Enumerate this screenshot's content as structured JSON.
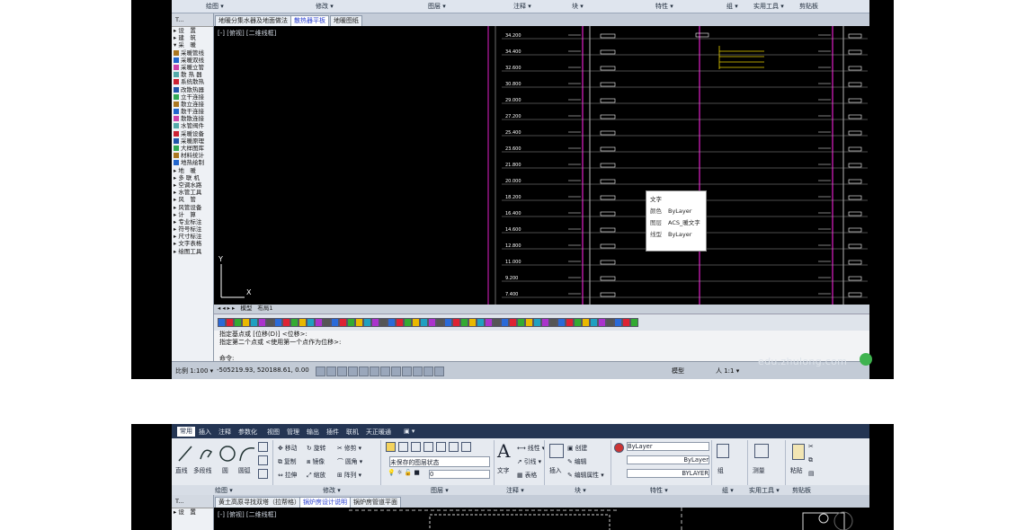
{
  "screenshot1": {
    "ribbon_groups": [
      "绘图 ▾",
      "修改 ▾",
      "图层 ▾",
      "注释 ▾",
      "块 ▾",
      "特性 ▾",
      "组 ▾",
      "实用工具 ▾",
      "剪贴板"
    ],
    "doc_tabs": [
      "地暖分集水器及地面做法",
      "散热器平板",
      "地暖图纸"
    ],
    "active_doc_tab": "散热器平板",
    "viewport_label": "[-] [俯视] [二维线框]",
    "tool_panel": {
      "header": "T...",
      "items": [
        "▸ 设　置",
        "▸ 建　筑",
        "▾ 采　暖",
        "采暖管线",
        "采暖双线",
        "采暖立管",
        "散 热 器",
        "系统散热",
        "改散热器",
        "立干连接",
        "散立连接",
        "散干连接",
        "散散连接",
        "水管阀件",
        "采暖设备",
        "采暖原理",
        "大样图库",
        "材料统计",
        "地热绘制",
        "▸ 地　暖",
        "▸ 多 联 机",
        "▸ 空调水路",
        "▸ 水管工具",
        "▸ 风　管",
        "▸ 风管设备",
        "▸ 计　算",
        "▸ 专业标注",
        "▸ 符号标注",
        "▸ 尺寸标注",
        "▸ 文字表格",
        "▸ 绘图工具"
      ]
    },
    "elevations": [
      "34.200",
      "34.400",
      "32.600",
      "30.800",
      "29.000",
      "27.200",
      "25.400",
      "23.600",
      "21.800",
      "20.000",
      "18.200",
      "16.400",
      "14.600",
      "12.800",
      "11.000",
      "9.200",
      "7.400"
    ],
    "axis_labels": {
      "y": "Y",
      "x": "X"
    },
    "layout_tabs": [
      "模型",
      "布局1"
    ],
    "tooltip": {
      "title": "文字",
      "rows": [
        {
          "k": "颜色",
          "v": "ByLayer"
        },
        {
          "k": "图层",
          "v": "ACS_暖文字"
        },
        {
          "k": "线型",
          "v": "ByLayer"
        }
      ]
    },
    "command_lines": [
      "指定基点或 [位移(D)] <位移>:",
      "指定第二个点或 <使用第一个点作为位移>:",
      "",
      "命令:"
    ],
    "status": {
      "scale": "比例 1:100 ▾",
      "coords": "-505219.93, 520188.61, 0.00",
      "right": "模型",
      "zoom": "人 1:1 ▾"
    },
    "watermark": "edu.zhulong.com",
    "colors": {
      "background": "#000000",
      "magenta": "#e020c8",
      "yellow": "#e8d000",
      "white": "#ffffff",
      "gray_line": "#9a9a9a",
      "tab_active": "#2a3fd0"
    }
  },
  "screenshot2": {
    "menu": [
      "常用",
      "插入",
      "注释",
      "参数化",
      "视图",
      "管理",
      "输出",
      "插件",
      "联机",
      "天正暖通",
      "▣ ▾"
    ],
    "active_menu": "常用",
    "ribbon_labels": {
      "line": "直线",
      "polyline": "多段线",
      "circle": "圆",
      "arc": "圆弧",
      "move": "移动",
      "rotate": "旋转",
      "trim": "修剪 ▾",
      "copy": "复制",
      "mirror": "镜像",
      "fillet": "圆角 ▾",
      "stretch": "拉伸",
      "scale": "缩放",
      "array": "阵列 ▾",
      "layer_state": "未保存的图层状态",
      "layer_name": "0",
      "text": "文字",
      "linear": "线性 ▾",
      "leader": "引线 ▾",
      "table": "表格",
      "insert": "插入",
      "create": "创建",
      "edit": "编辑",
      "edit_attr": "编辑属性 ▾",
      "bylayer1": "ByLayer",
      "bylayer2": "ByLayer",
      "bylayer3": "BYLAYER",
      "group": "组",
      "measure": "测量",
      "paste": "粘贴"
    },
    "group_bar": [
      "绘图 ▾",
      "修改 ▾",
      "图层 ▾",
      "注释 ▾",
      "块 ▾",
      "特性 ▾",
      "组 ▾",
      "实用工具 ▾",
      "剪贴板"
    ],
    "doc_tabs": [
      "黄土高原寻找双塔（拉帮格）",
      "锅炉房设计说明",
      "锅炉房管道平面"
    ],
    "active_doc_tab": "锅炉房设计说明",
    "viewport_label": "[-] [俯视] [二维线框]",
    "tool_panel_header": "T..."
  }
}
